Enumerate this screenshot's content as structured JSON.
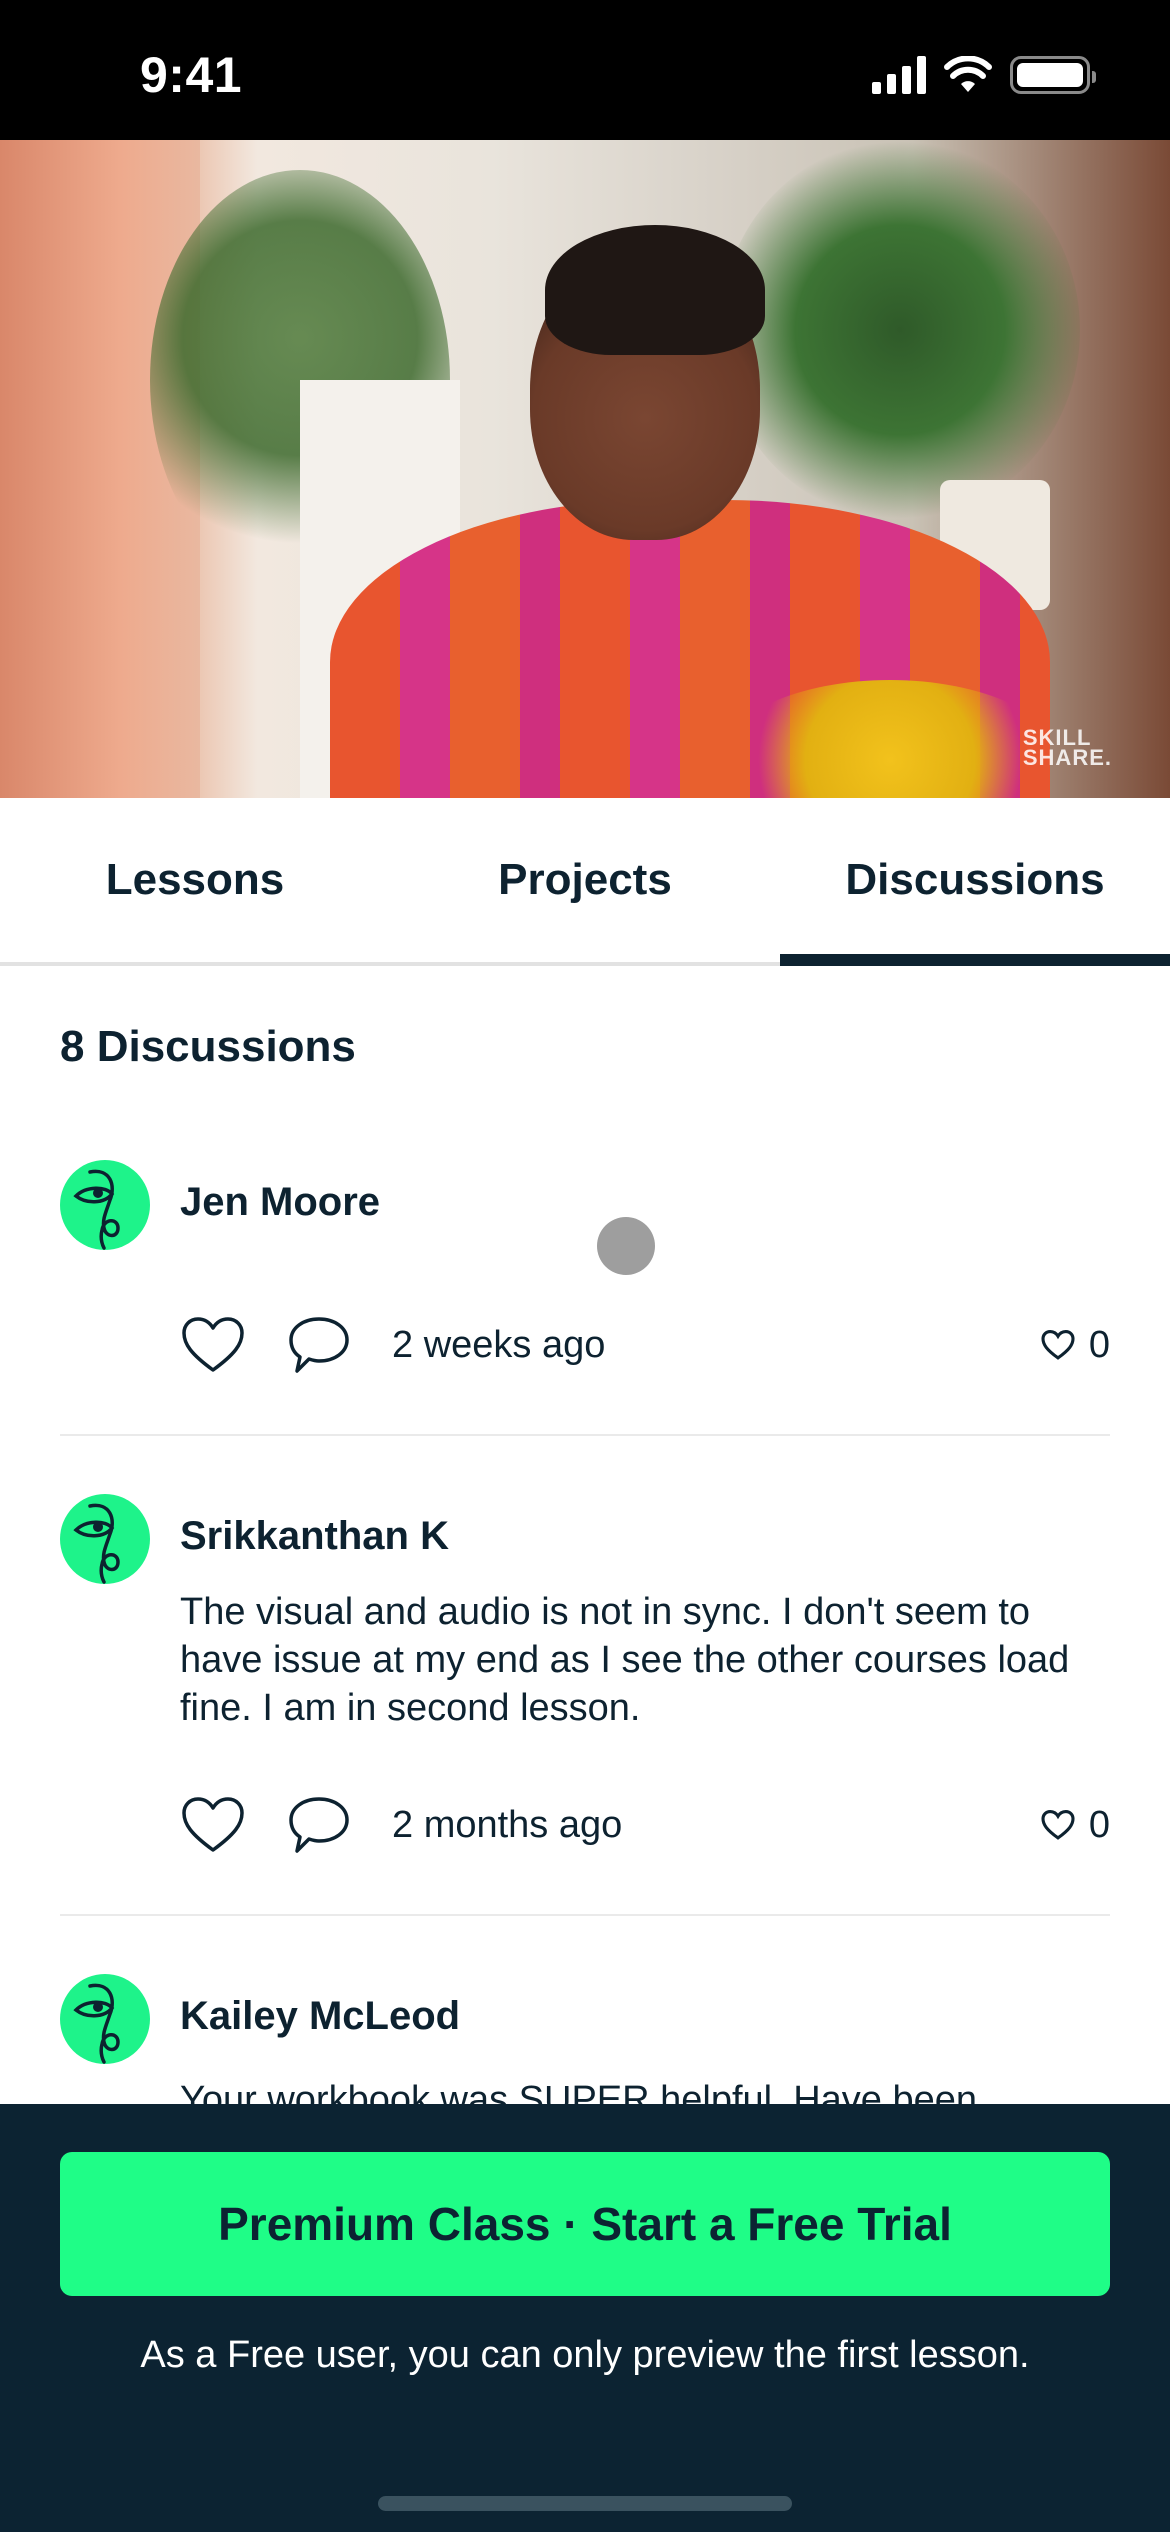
{
  "status_bar": {
    "time": "9:41",
    "icons": [
      "cellular-signal-icon",
      "wifi-icon",
      "battery-icon"
    ]
  },
  "video": {
    "watermark_line1": "SKILL",
    "watermark_line2": "SHARE."
  },
  "tabs": [
    {
      "label": "Lessons",
      "active": false
    },
    {
      "label": "Projects",
      "active": false
    },
    {
      "label": "Discussions",
      "active": true
    }
  ],
  "discussions": {
    "count_title": "8 Discussions",
    "posts": [
      {
        "author": "Jen Moore",
        "body": "",
        "time": "2 weeks ago",
        "likes": "0"
      },
      {
        "author": "Srikkanthan K",
        "body": "The visual and audio is not in sync. I don't seem to have issue at my end as I see the other courses load fine. I am in second lesson.",
        "time": "2 months ago",
        "likes": "0"
      },
      {
        "author": "Kailey McLeod",
        "body": "Your workbook was SUPER helpful. Have been",
        "time": "",
        "likes": ""
      }
    ]
  },
  "footer": {
    "cta_label": "Premium Class · Start a Free Trial",
    "notice": "As a Free user, you can only preview the first lesson."
  },
  "colors": {
    "accent_green": "#1ffd87",
    "navy": "#0c2332",
    "avatar_green": "#1ef38a"
  }
}
